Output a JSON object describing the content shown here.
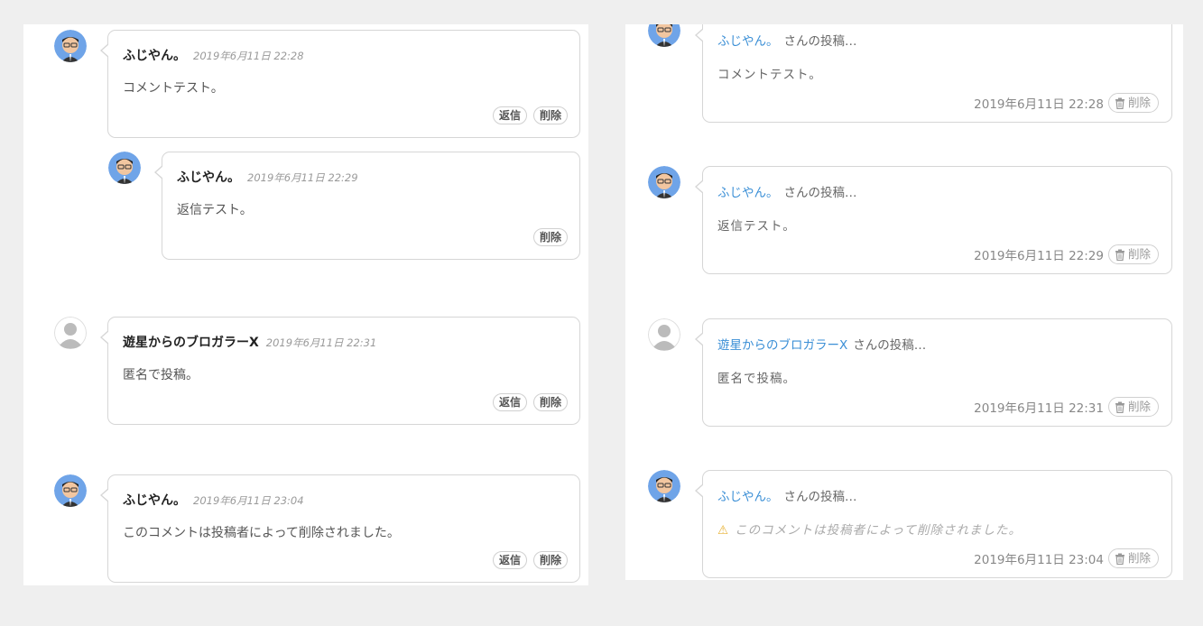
{
  "left": {
    "comments": [
      {
        "author": "ふじやん。",
        "date": "2019年6月11日 22:28",
        "text": "コメントテスト。",
        "reply": "返信",
        "delete": "削除",
        "avatar": "user-avatar"
      },
      {
        "author": "ふじやん。",
        "date": "2019年6月11日 22:29",
        "text": "返信テスト。",
        "delete": "削除",
        "avatar": "user-avatar"
      },
      {
        "author": "遊星からのブロガラーX",
        "date": "2019年6月11日 22:31",
        "text": "匿名で投稿。",
        "reply": "返信",
        "delete": "削除",
        "avatar": "anonymous-avatar"
      },
      {
        "author": "ふじやん。",
        "date": "2019年6月11日 23:04",
        "text": "このコメントは投稿者によって削除されました。",
        "reply": "返信",
        "delete": "削除",
        "avatar": "user-avatar"
      }
    ]
  },
  "right": {
    "comments": [
      {
        "author": "ふじやん。",
        "suffix": "さんの投稿…",
        "text": "コメントテスト。",
        "date": "2019年6月11日 22:28",
        "delete": "削除"
      },
      {
        "author": "ふじやん。",
        "suffix": "さんの投稿…",
        "text": "返信テスト。",
        "date": "2019年6月11日 22:29",
        "delete": "削除"
      },
      {
        "author": "遊星からのブロガラーX",
        "suffix": "さんの投稿…",
        "text": "匿名で投稿。",
        "date": "2019年6月11日 22:31",
        "delete": "削除"
      },
      {
        "author": "ふじやん。",
        "suffix": "さんの投稿…",
        "text": "このコメントは投稿者によって削除されました。",
        "date": "2019年6月11日 23:04",
        "delete": "削除",
        "deleted": true
      }
    ]
  },
  "colors": {
    "link": "#3b8fd6",
    "warning": "#e8b337",
    "background": "#efefef"
  }
}
